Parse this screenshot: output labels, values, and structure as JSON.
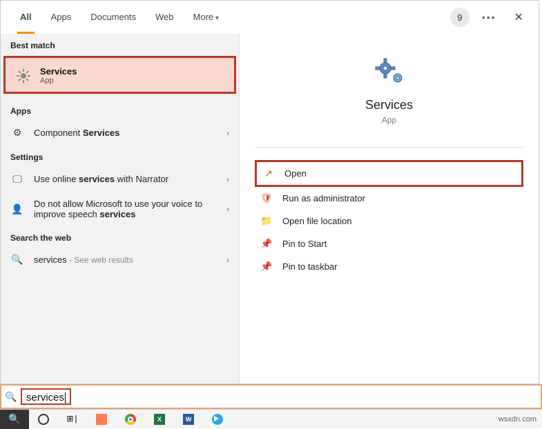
{
  "tabs": {
    "all": "All",
    "apps": "Apps",
    "documents": "Documents",
    "web": "Web",
    "more": "More"
  },
  "badge": "9",
  "sections": {
    "best_match": "Best match",
    "apps": "Apps",
    "settings": "Settings",
    "web": "Search the web"
  },
  "best_match": {
    "title": "Services",
    "subtitle": "App"
  },
  "apps_list": {
    "component_pre": "Component ",
    "component_bold": "Services"
  },
  "settings_list": {
    "s1_pre": "Use online ",
    "s1_bold": "services",
    "s1_post": " with Narrator",
    "s2_pre": "Do not allow Microsoft to use your voice to improve speech ",
    "s2_bold": "services"
  },
  "web_list": {
    "term": "services",
    "note": " - See web results"
  },
  "details": {
    "title": "Services",
    "subtitle": "App",
    "actions": {
      "open": "Open",
      "run_admin": "Run as administrator",
      "file_loc": "Open file location",
      "pin_start": "Pin to Start",
      "pin_taskbar": "Pin to taskbar"
    }
  },
  "search_input": "services",
  "watermark": "wsxdn.com"
}
